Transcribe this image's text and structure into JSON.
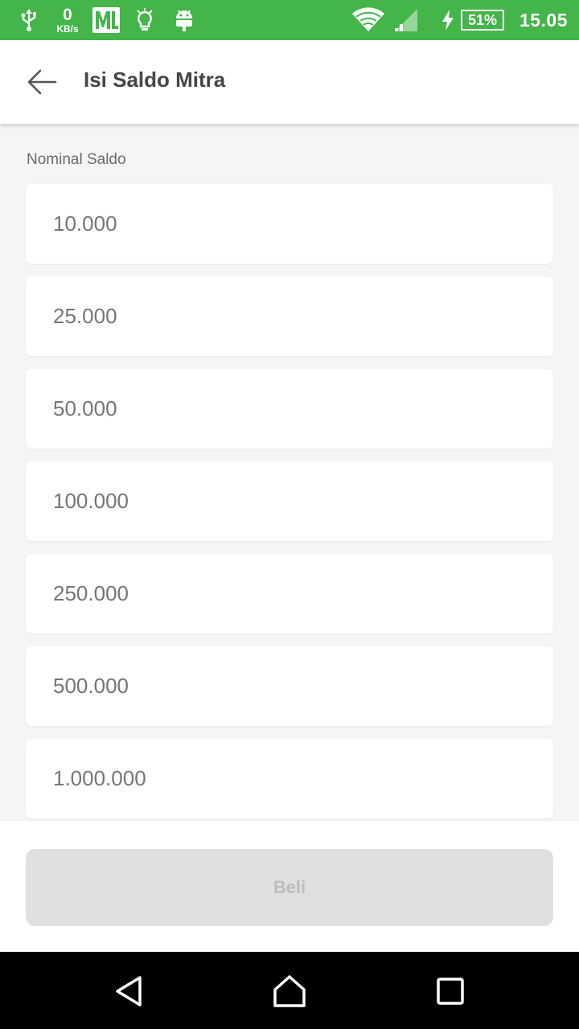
{
  "status_bar": {
    "net_speed_value": "0",
    "net_speed_unit": "KB/s",
    "ml_badge": "ML",
    "battery_level": "51%",
    "time": "15.05",
    "color": "#43b549",
    "icons": [
      "usb-icon",
      "ml-app-icon",
      "bulb-icon",
      "android-icon",
      "wifi-icon",
      "signal-icon",
      "charging-icon",
      "battery-icon"
    ]
  },
  "app_bar": {
    "title": "Isi Saldo Mitra",
    "back_icon": "arrow-left-icon"
  },
  "main": {
    "label": "Nominal Saldo",
    "options": [
      "10.000",
      "25.000",
      "50.000",
      "100.000",
      "250.000",
      "500.000",
      "1.000.000"
    ]
  },
  "footer": {
    "buy_label": "Beli"
  },
  "nav_bar": {
    "icons": [
      "nav-back-icon",
      "nav-home-icon",
      "nav-recent-icon"
    ]
  }
}
